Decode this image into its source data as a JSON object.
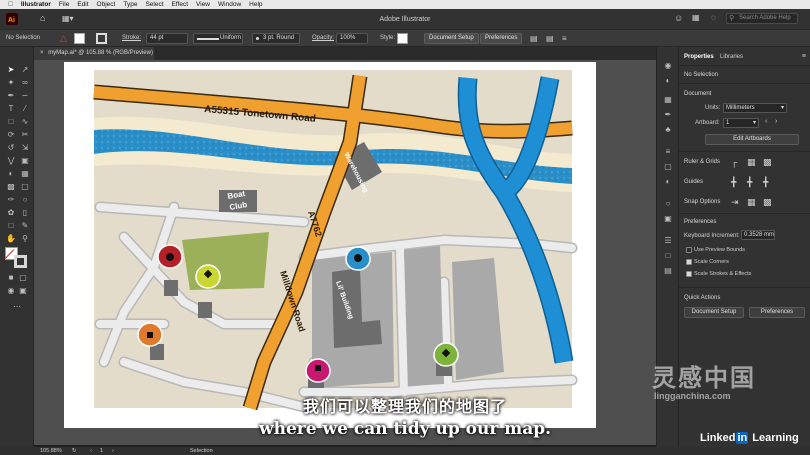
{
  "menubar": {
    "app": "Illustrator",
    "items": [
      "File",
      "Edit",
      "Object",
      "Type",
      "Select",
      "Effect",
      "View",
      "Window",
      "Help"
    ]
  },
  "appbar": {
    "title": "Adobe Illustrator",
    "search_placeholder": "Search Adobe Help"
  },
  "control_bar": {
    "selection": "No Selection",
    "stroke_label": "Stroke:",
    "stroke_value": "44 pt",
    "profile": "Uniform",
    "brush": "3 pt. Round",
    "opacity_label": "Opacity:",
    "opacity_value": "100%",
    "style_label": "Style:",
    "document_setup": "Document Setup",
    "preferences": "Preferences"
  },
  "document_tab": {
    "title": "myMap.ai* @ 105.88 % (RGB/Preview)"
  },
  "map": {
    "road_a55315": "A55315 Tonetown Road",
    "road_a7762": "A7762",
    "road_milldown": "Milldown Road",
    "building_boat_club_1": "Boat",
    "building_boat_club_2": "Club",
    "building_warehousing": "Warehousing",
    "building_lil": "Lil' Building",
    "colors": {
      "land": "#e3dccb",
      "water": "#2a8fc9",
      "road_orange": "#f0a02e",
      "road_gray": "#dcdcdc",
      "park": "#9cb05a",
      "building": "#6d6d6d",
      "highway_blue": "#1e8fd4",
      "sand": "#f3ead0",
      "pin_black": "#b3202a",
      "pin_yellow": "#c9d733",
      "pin_orange": "#e07a2c",
      "pin_magenta": "#c9186f",
      "pin_blue": "#2a8fc9",
      "pin_green": "#7db33b"
    }
  },
  "panel": {
    "tab_properties": "Properties",
    "tab_libraries": "Libraries",
    "no_selection": "No Selection",
    "document": "Document",
    "units_label": "Units:",
    "units_value": "Millimeters",
    "artboard_label": "Artboard:",
    "artboard_value": "1",
    "edit_artboards": "Edit Artboards",
    "ruler_grids": "Ruler & Grids",
    "guides": "Guides",
    "snap_options": "Snap Options",
    "preferences": "Preferences",
    "keyboard_increment_label": "Keyboard Increment:",
    "keyboard_increment_value": "0.3528 mm",
    "use_preview_bounds": "Use Preview Bounds",
    "scale_corners": "Scale Corners",
    "scale_strokes": "Scale Strokes & Effects",
    "quick_actions": "Quick Actions",
    "qa_document_setup": "Document Setup",
    "qa_preferences": "Preferences"
  },
  "statusbar": {
    "zoom": "105.88%",
    "artboard": "1",
    "tool": "Selection"
  },
  "subtitles": {
    "chinese": "我们可以整理我们的地图了",
    "english": "where we can tidy up our map."
  },
  "watermark": {
    "cn": "灵感中国",
    "url": "lingganchina.com",
    "brand_a": "Linked",
    "brand_b": "in",
    "brand_c": " Learning"
  }
}
